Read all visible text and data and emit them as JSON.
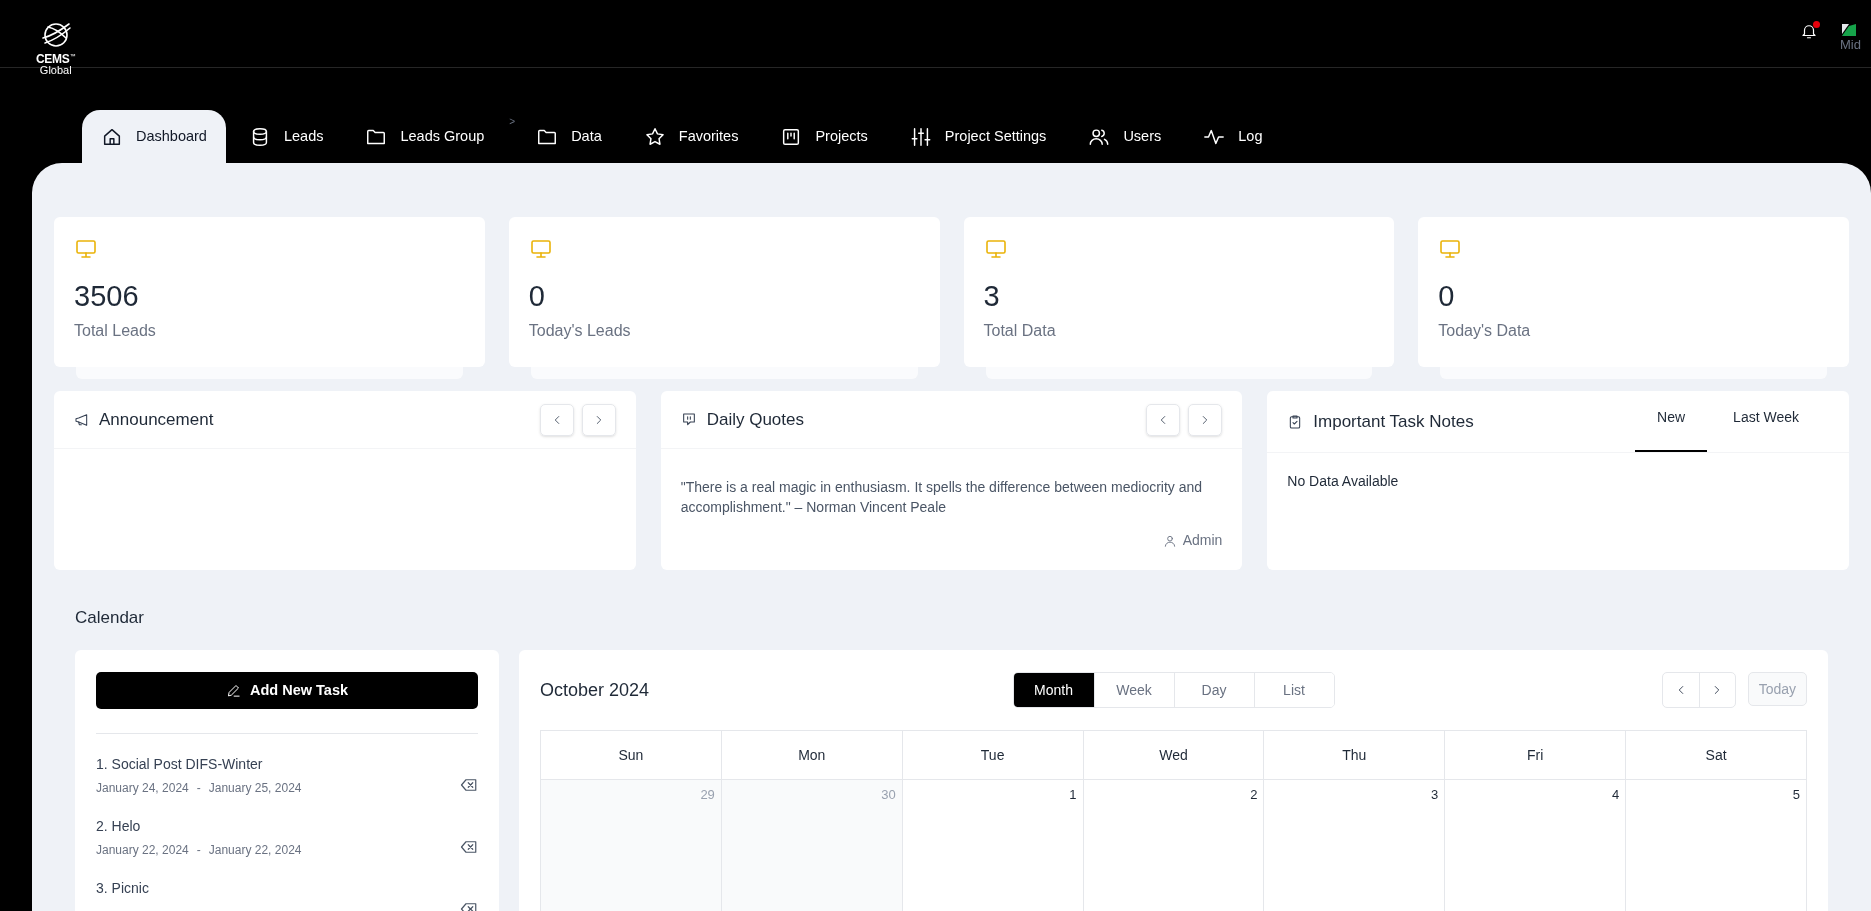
{
  "header": {
    "logo": {
      "name": "CEMS",
      "trademark": "™",
      "tagline": "Global"
    },
    "notifications": {
      "unread": true
    },
    "user": {
      "name": "Mid"
    }
  },
  "nav": {
    "items": [
      {
        "kind": "tab",
        "label": "Dashboard",
        "selected": true
      },
      {
        "kind": "tab",
        "label": "Leads",
        "selected": false
      },
      {
        "kind": "tab",
        "label": "Leads Group",
        "selected": false
      },
      {
        "kind": "separator",
        "label": ">"
      },
      {
        "kind": "tab",
        "label": "Data",
        "selected": false
      },
      {
        "kind": "tab",
        "label": "Favorites",
        "selected": false
      },
      {
        "kind": "tab",
        "label": "Projects",
        "selected": false
      },
      {
        "kind": "tab",
        "label": "Project Settings",
        "selected": false
      },
      {
        "kind": "tab",
        "label": "Users",
        "selected": false
      },
      {
        "kind": "tab",
        "label": "Log",
        "selected": false
      }
    ]
  },
  "stats": [
    {
      "value": "3506",
      "label": "Total Leads"
    },
    {
      "value": "0",
      "label": "Today's Leads"
    },
    {
      "value": "3",
      "label": "Total Data"
    },
    {
      "value": "0",
      "label": "Today's Data"
    }
  ],
  "announcement": {
    "title": "Announcement"
  },
  "daily_quotes": {
    "title": "Daily Quotes",
    "quote": "\"There is a real magic in enthusiasm. It spells the difference between mediocrity and accomplishment.\" – Norman Vincent Peale",
    "author": "Admin"
  },
  "task_notes": {
    "title": "Important Task Notes",
    "tabs": [
      {
        "label": "New",
        "selected": true
      },
      {
        "label": "Last Week",
        "selected": false
      }
    ],
    "empty_text": "No Data Available"
  },
  "calendar": {
    "title": "Calendar",
    "add_button": "Add New Task",
    "tasks": [
      {
        "title": "1. Social Post DIFS-Winter",
        "start": "January 24, 2024",
        "separator": "-",
        "end": "January 25, 2024"
      },
      {
        "title": "2. Helo",
        "start": "January 22, 2024",
        "separator": "-",
        "end": "January 22, 2024"
      },
      {
        "title": "3. Picnic"
      }
    ],
    "month_title": "October 2024",
    "views": [
      {
        "label": "Month",
        "selected": true
      },
      {
        "label": "Week",
        "selected": false
      },
      {
        "label": "Day",
        "selected": false
      },
      {
        "label": "List",
        "selected": false
      }
    ],
    "today_button": {
      "label": "Today",
      "disabled": true
    },
    "weekdays": [
      "Sun",
      "Mon",
      "Tue",
      "Wed",
      "Thu",
      "Fri",
      "Sat"
    ],
    "days": [
      {
        "label": "29",
        "other_month": true
      },
      {
        "label": "30",
        "other_month": true
      },
      {
        "label": "1",
        "other_month": false
      },
      {
        "label": "2",
        "other_month": false
      },
      {
        "label": "3",
        "other_month": false
      },
      {
        "label": "4",
        "other_month": false
      },
      {
        "label": "5",
        "other_month": false
      }
    ]
  }
}
